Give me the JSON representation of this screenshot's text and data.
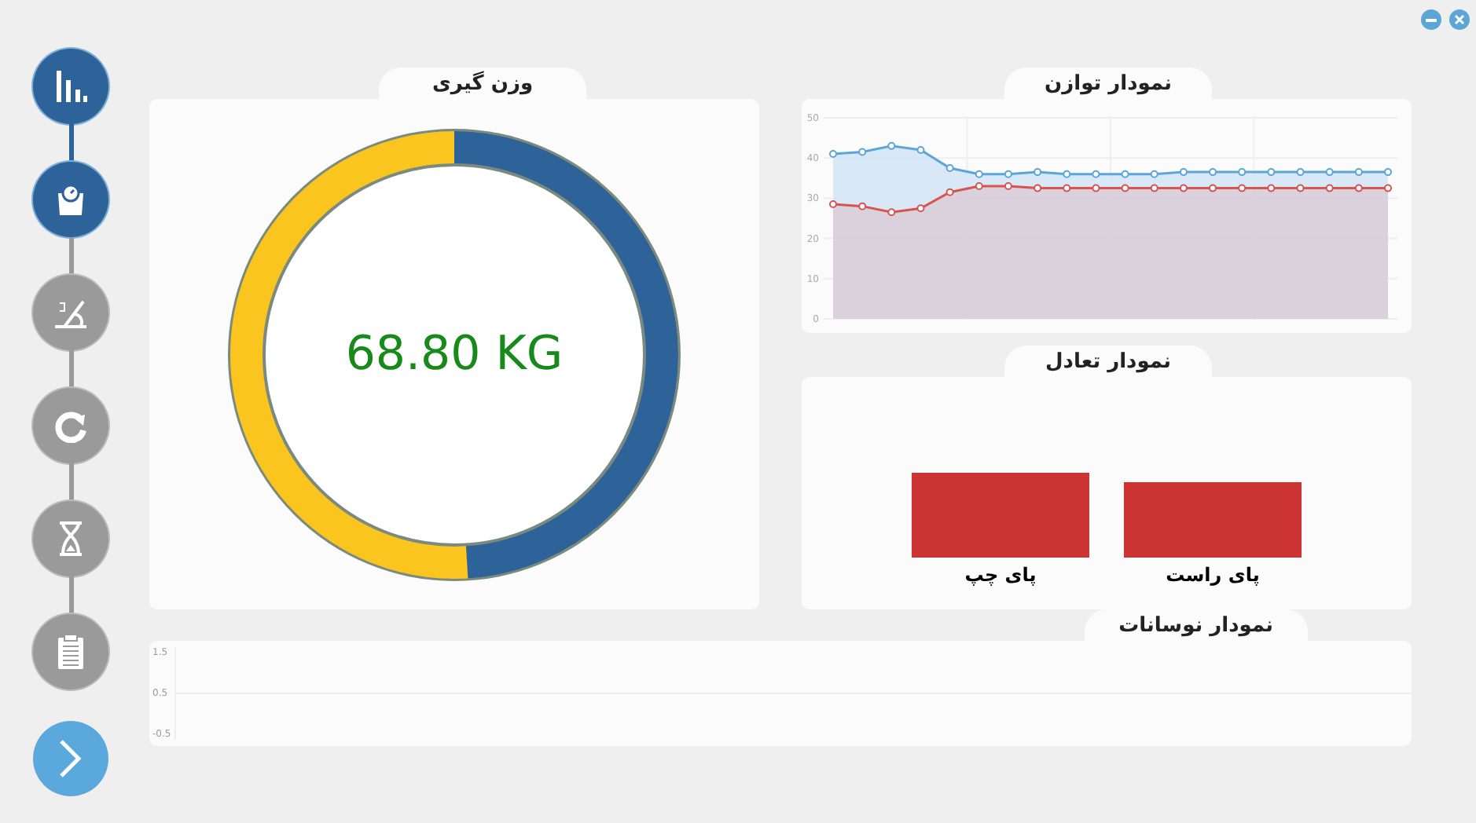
{
  "window_controls": [
    {
      "kind": "minimize"
    },
    {
      "kind": "close"
    }
  ],
  "steps": [
    {
      "kind": "chart",
      "active": true
    },
    {
      "kind": "scale",
      "active": true
    },
    {
      "kind": "angle",
      "active": false
    },
    {
      "kind": "rotate",
      "active": false
    },
    {
      "kind": "timer",
      "active": false
    },
    {
      "kind": "clipboard",
      "active": false
    }
  ],
  "weight_card": {
    "title": "وزن گیری",
    "reading": "68.80 KG",
    "gauge": {
      "level": 0.49
    }
  },
  "balance_card": {
    "title": "نمودار توازن",
    "chart_data": {
      "type": "area",
      "grid": true,
      "ylim": [
        0,
        50
      ],
      "yticks": [
        0,
        10,
        20,
        30,
        40,
        50
      ],
      "series": [
        {
          "color": "#5ba6d6",
          "values": [
            41,
            41.5,
            43,
            42,
            37.5,
            36,
            36,
            36.5,
            36,
            36,
            36,
            36,
            36.5,
            36.5,
            36.5,
            36.5,
            36.5,
            36.5,
            36.5,
            36.5
          ]
        },
        {
          "color": "#d9534f",
          "values": [
            28.5,
            28,
            26.5,
            27.5,
            31.5,
            33,
            33,
            32.5,
            32.5,
            32.5,
            32.5,
            32.5,
            32.5,
            32.5,
            32.5,
            32.5,
            32.5,
            32.5,
            32.5,
            32.5
          ]
        }
      ]
    }
  },
  "equilibrium_card": {
    "title": "نمودار تعادل",
    "bars": [
      {
        "label": "پای راست"
      },
      {
        "label": "پای چپ"
      }
    ]
  },
  "oscillation_card": {
    "title": "نمودار نوسانات",
    "y_tick_labels": [
      "1.5",
      "0.5",
      "-0.5"
    ]
  }
}
